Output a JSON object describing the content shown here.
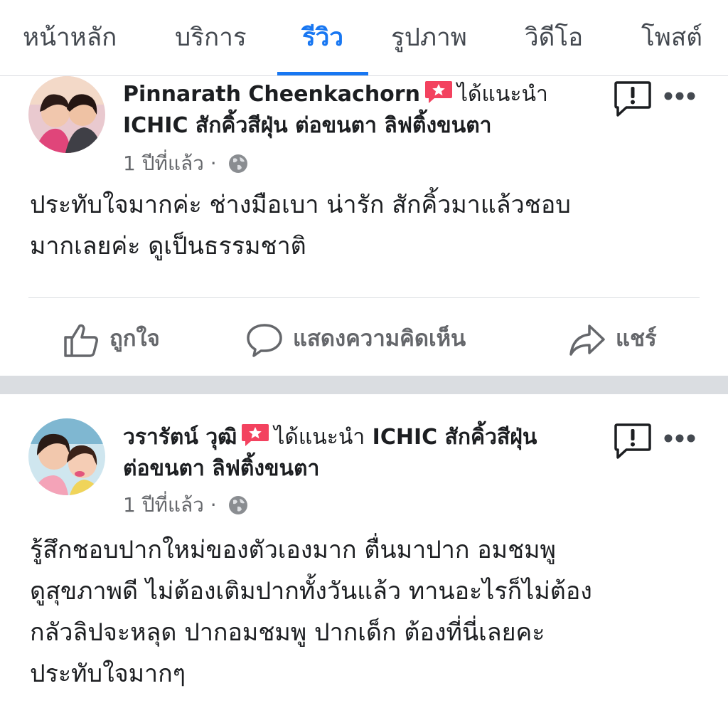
{
  "tabs": [
    {
      "label": "หน้าหลัก"
    },
    {
      "label": "บริการ"
    },
    {
      "label": "รีวิว"
    },
    {
      "label": "รูปภาพ"
    },
    {
      "label": "วิดีโอ"
    },
    {
      "label": "โพสต์"
    }
  ],
  "active_tab": "รีวิว",
  "reviews": [
    {
      "author": "Pinnarath Cheenkachorn",
      "recommends": "ได้แนะนำ",
      "page_line1": "",
      "page_line2": "ICHIC สักคิ้วสีฝุ่น ต่อขนตา ลิฟติ้งขนตา",
      "time": "1 ปีที่แล้ว",
      "separator": "·",
      "text_lines": [
        "ประทับใจมากค่ะ ช่างมือเบา น่ารัก สักคิ้วมาแล้วชอบ",
        "มากเลยค่ะ ดูเป็นธรรมชาติ"
      ]
    },
    {
      "author": "วรารัตน์ วุฒิ",
      "recommends": "ได้แนะนำ",
      "page_line1": "ICHIC สักคิ้วสีฝุ่น",
      "page_line2": "ต่อขนตา ลิฟติ้งขนตา",
      "time": "1 ปีที่แล้ว",
      "separator": "·",
      "text_lines": [
        "รู้สึกชอบปากใหม่ของตัวเองมาก ตื่นมาปาก อมชมพู",
        "ดูสุขภาพดี ไม่ต้องเติมปากทั้งวันแล้ว ทานอะไรก็ไม่ต้อง",
        "กลัวลิปจะหลุด ปากอมชมพู ปากเด็ก ต้องที่นี่เลยคะ",
        "ประทับใจมากๆ"
      ]
    }
  ],
  "actions": {
    "like": "ถูกใจ",
    "comment": "แสดงความคิดเห็น",
    "share": "แชร์"
  },
  "colors": {
    "accent": "#1877f2",
    "badge": "#f3425f",
    "text": "#1c1e21",
    "muted": "#65676b",
    "divider": "#dadde1"
  },
  "icons": [
    "recommend-badge-icon",
    "globe-icon",
    "report-icon",
    "more-icon",
    "like-icon",
    "comment-icon",
    "share-icon"
  ]
}
